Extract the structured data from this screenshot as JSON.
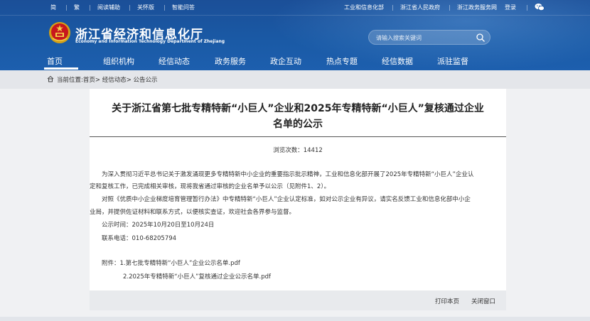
{
  "topbar": {
    "left": [
      "简",
      "繁",
      "阅读辅助",
      "关怀版",
      "智能问答"
    ],
    "right": [
      "工业和信息化部",
      "浙江省人民政府",
      "浙江政务服务网",
      "登录"
    ]
  },
  "site": {
    "title": "浙江省经济和信息化厅",
    "subtitle": "Economy and Information Technology Department of Zhejiang"
  },
  "search": {
    "placeholder": "请输入搜索关键词"
  },
  "nav": [
    "首页",
    "组织机构",
    "经信动态",
    "政务服务",
    "政企互动",
    "热点专题",
    "经信数据",
    "派驻监督"
  ],
  "breadcrumb": "当前位置:首页> 经信动态> 公告公示",
  "article": {
    "title_line1": "关于浙江省第七批专精特新“小巨人”企业和2025年专精特新“小巨人”复核通过企业",
    "title_line2": "名单的公示",
    "views": "浏览次数：14412",
    "p1_line1": "为深入贯彻习近平总书记关于激发涌现更多专精特新中小企业的重要指示批示精神，工业和信息化部开展了2025年专精特新“小巨人”企业认",
    "p1_line2": "定和复核工作，已完成相关审核，现将我省通过审核的企业名单予以公示（见附件1、2）。",
    "p2_line1": "对照《优质中小企业梯度培育管理暂行办法》中专精特新“小巨人”企业认定标准，如对公示企业有异议，请实名反馈工业和信息化部中小企",
    "p2_line2": "业局，并提供佐证材料和联系方式，以便核实查证，欢迎社会各界参与监督。",
    "period": "公示时间：2025年10月20日至10月24日",
    "phone": "联系电话：010-68205794",
    "attach1": "附件：1.第七批专精特新“小巨人”企业公示名单.pdf",
    "attach2": "2.2025年专精特新“小巨人”复核通过企业公示名单.pdf",
    "print": "打印本页",
    "close": "关闭窗口"
  },
  "colors": {
    "header": "#1b57a3",
    "accent": "#ffffff"
  }
}
